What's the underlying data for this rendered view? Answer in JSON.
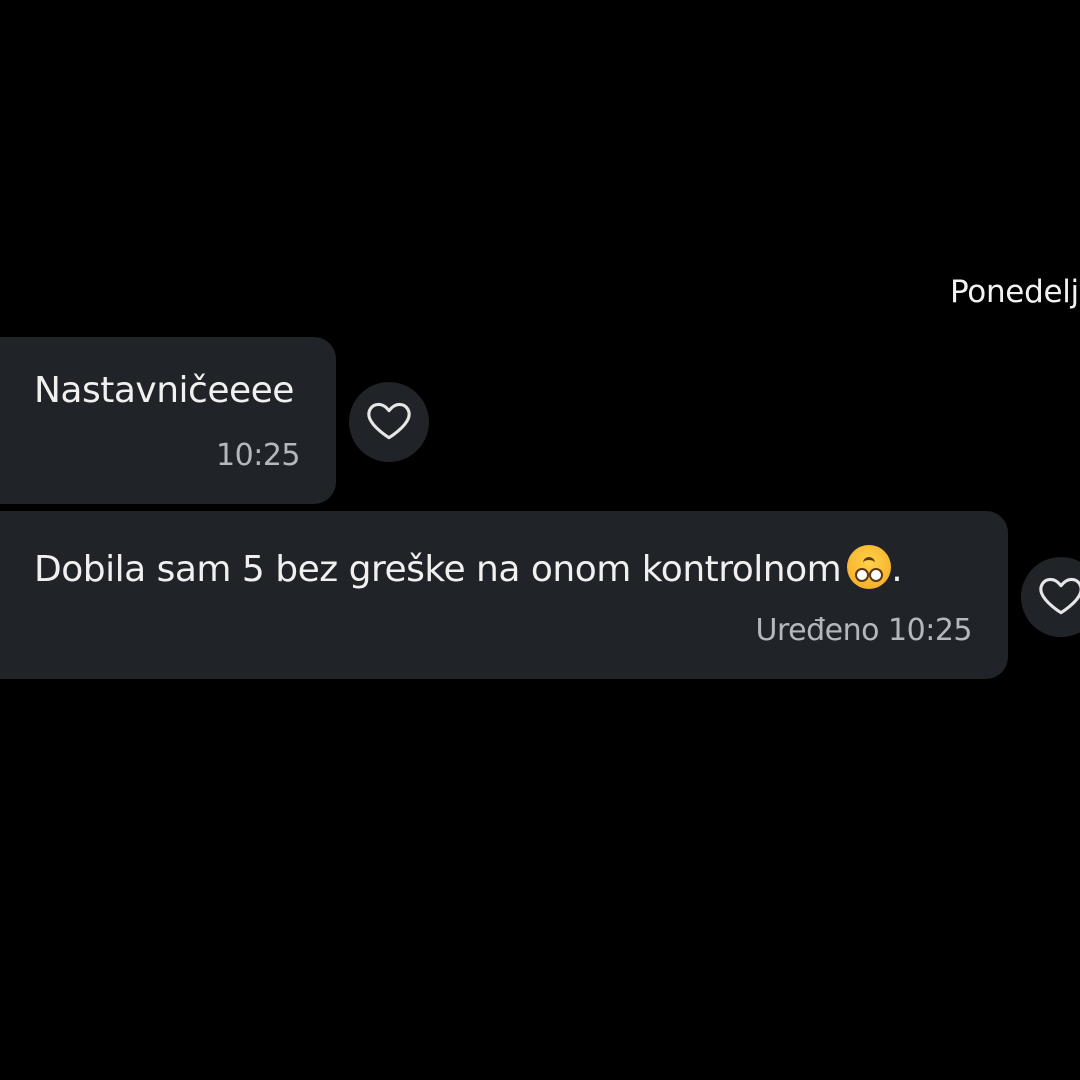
{
  "conversation": {
    "date_divider": "Ponedelj",
    "messages": [
      {
        "text": "Nastavničeeee",
        "meta": "10:25",
        "reaction_icon": "heart-outline-icon"
      },
      {
        "text": "Dobila sam 5 bez greške na onom kontrolnom",
        "emoji": "upside-down-face-emoji",
        "text_suffix": ".",
        "meta": "Uređeno 10:25",
        "reaction_icon": "heart-outline-icon"
      }
    ]
  },
  "colors": {
    "background": "#000000",
    "bubble": "#202327",
    "text": "#f0f0f0",
    "meta_text": "#b4b8bd",
    "emoji": "#f5a623"
  }
}
